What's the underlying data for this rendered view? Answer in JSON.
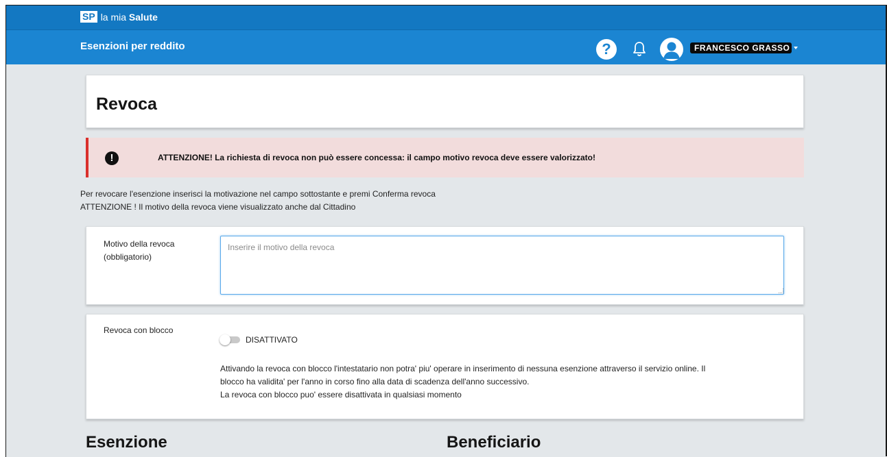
{
  "app": {
    "logo": "SP",
    "brand_prefix": "la mia ",
    "brand_name": "Salute"
  },
  "header": {
    "section_title": "Esenzioni per reddito",
    "help_icon": "question-circle-icon",
    "help_glyph": "?",
    "notifications_icon": "bell-icon",
    "user_icon": "user-avatar-icon",
    "user_name": "FRANCESCO GRASSO"
  },
  "page": {
    "title": "Revoca"
  },
  "alert": {
    "icon": "exclamation-circle-icon",
    "glyph": "!",
    "message": "ATTENZIONE! La richiesta di revoca non può essere concessa: il campo motivo revoca deve essere valorizzato!",
    "color": "#d9302c"
  },
  "info": {
    "line1": "Per revocare l'esenzione inserisci la motivazione nel campo sottostante e premi Conferma revoca",
    "line2": "ATTENZIONE ! Il motivo della revoca viene visualizzato anche dal Cittadino"
  },
  "motivo": {
    "label_line1": "Motivo della revoca",
    "label_line2": "(obbligatorio)",
    "value": "",
    "placeholder": "Inserire il motivo della revoca"
  },
  "blocco": {
    "label": "Revoca con blocco",
    "toggle_state": "DISATTIVATO",
    "desc_line1": "Attivando la revoca con blocco l'intestatario non potra' piu' operare in inserimento di nessuna esenzione attraverso il servizio online. Il",
    "desc_line2": "blocco ha validita' per l'anno in corso fino alla data di scadenza dell'anno successivo.",
    "desc_line3": "La revoca con blocco puo' essere disattivata in qualsiasi momento"
  },
  "sections": {
    "esenzione": "Esenzione",
    "beneficiario": "Beneficiario"
  },
  "colors": {
    "header_primary": "#1b85d2",
    "header_dark": "#1378c2",
    "background": "#e3e7ea",
    "alert_background": "#f2dcdc"
  }
}
